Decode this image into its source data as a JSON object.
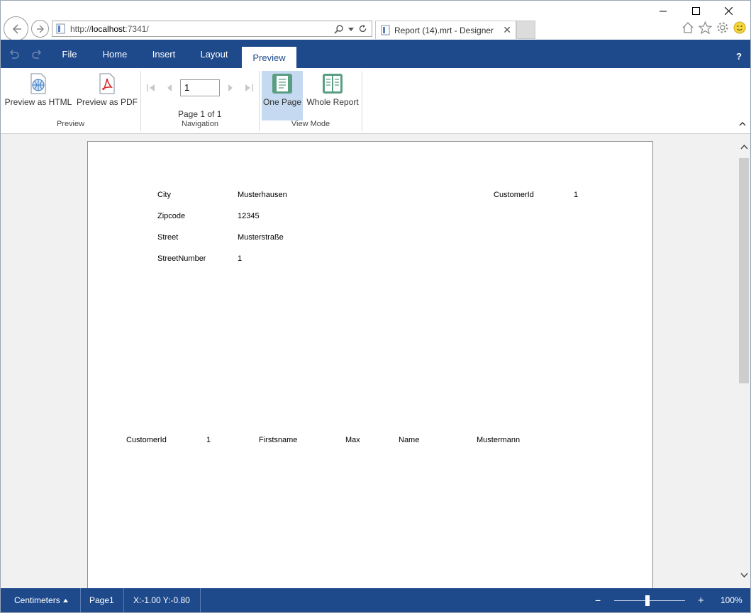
{
  "browser": {
    "url_prefix": "http://",
    "url_host": "localhost",
    "url_suffix": ":7341/",
    "tab_title": "Report (14).mrt - Designer",
    "tab_close": "✕"
  },
  "ribbon_tabs": [
    "File",
    "Home",
    "Insert",
    "Layout",
    "Preview"
  ],
  "selected_tab": "Preview",
  "help_label": "?",
  "groups": {
    "preview": {
      "label": "Preview",
      "html_label": "Preview as HTML",
      "pdf_label": "Preview as PDF"
    },
    "navigation": {
      "label": "Navigation",
      "page_value": "1",
      "page_info": "Page 1 of 1"
    },
    "view_mode": {
      "label": "View Mode",
      "one_page_label": "One Page",
      "whole_report_label": "Whole Report"
    }
  },
  "report": {
    "fields": {
      "city_label": "City",
      "city_value": "Musterhausen",
      "customerid_label": "CustomerId",
      "customerid_value": "1",
      "zipcode_label": "Zipcode",
      "zipcode_value": "12345",
      "street_label": "Street",
      "street_value": "Musterstraße",
      "streetnumber_label": "StreetNumber",
      "streetnumber_value": "1"
    },
    "detail": {
      "customerid_label": "CustomerId",
      "customerid_value": "1",
      "firstname_label": "Firstsname",
      "firstname_value": "Max",
      "name_label": "Name",
      "name_value": "Mustermann"
    }
  },
  "status": {
    "units": "Centimeters",
    "page": "Page1",
    "coords": "X:-1.00 Y:-0.80",
    "zoom_minus": "−",
    "zoom_plus": "+",
    "zoom": "100%",
    "zoom_level": 0.5
  },
  "colors": {
    "accent": "#1e4a8c",
    "selected_view": "#c5d9f1"
  }
}
